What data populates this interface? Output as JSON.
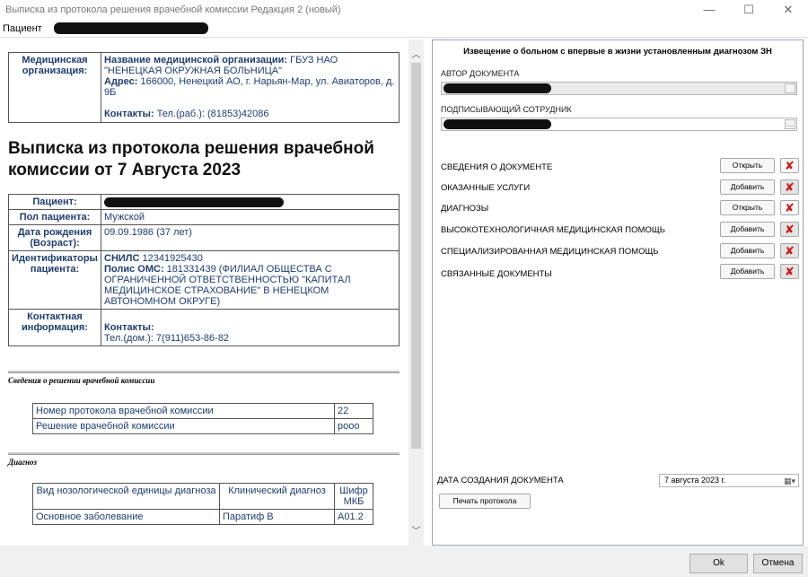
{
  "window": {
    "title": "Выписка из протокола решения врачебной комиссии Редакция 2 (новый)",
    "minimize": "—",
    "maximize": "☐",
    "close": "✕"
  },
  "tabs": {
    "patient_tab": "Пациент"
  },
  "document": {
    "org": {
      "label": "Медицинская организация:",
      "name_label": "Название медицинской организации:",
      "name_value": "ГБУЗ НАО \"НЕНЕЦКАЯ ОКРУЖНАЯ БОЛЬНИЦА\"",
      "address_label": "Адрес:",
      "address_value": "166000, Ненецкий АО, г. Нарьян-Мар, ул. Авиаторов, д. 9Б",
      "contacts_label": "Контакты:",
      "contacts_value": "Тел.(раб.): (81853)42086"
    },
    "title": "Выписка из протокола решения врачебной комиссии от 7 Августа 2023",
    "patient": {
      "patient_label": "Пациент:",
      "sex_label": "Пол пациента:",
      "sex_value": "Мужской",
      "birth_label": "Дата рождения (Возраст):",
      "birth_value": "09.09.1986 (37 лет)",
      "ids_label": "Идентификаторы пациента:",
      "snils_label": "СНИЛС",
      "snils_value": "12341925430",
      "oms_label": "Полис ОМС:",
      "oms_value": "181331439 (ФИЛИАЛ ОБЩЕСТВА С ОГРАНИЧЕННОЙ ОТВЕТСТВЕННОСТЬЮ \"КАПИТАЛ МЕДИЦИНСКОЕ СТРАХОВАНИЕ\" В НЕНЕЦКОМ АВТОНОМНОМ ОКРУГЕ)",
      "contact_label": "Контактная информация:",
      "contact_title": "Контакты:",
      "contact_value": "Тел.(дом.): 7(911)653-86-82"
    },
    "commission_section": {
      "title": "Сведения о решении врачебной комиссии",
      "rows": [
        {
          "name": "Номер протокола врачебной комиссии",
          "value": "22"
        },
        {
          "name": "Решение врачебной комиссии",
          "value": "рооо"
        }
      ]
    },
    "diagnosis_section": {
      "title": "Диагноз",
      "headers": [
        "Вид нозологической единицы диагноза",
        "Клинический диагноз",
        "Шифр МКБ"
      ],
      "rows": [
        {
          "kind": "Основное заболевание",
          "clinical": "Паратиф B",
          "code": "A01.2"
        }
      ]
    }
  },
  "right_panel": {
    "title": "Извещение о больном с впервые в жизни установленным диагнозом ЗН",
    "author_label": "АВТОР ДОКУМЕНТА",
    "signer_label": "ПОДПИСЫВАЮЩИЙ СОТРУДНИК",
    "ellipsis": "...",
    "rows": [
      {
        "label": "СВЕДЕНИЯ О ДОКУМЕНТЕ",
        "button": "Открыть"
      },
      {
        "label": "ОКАЗАННЫЕ УСЛУГИ",
        "button": "Добавить"
      },
      {
        "label": "ДИАГНОЗЫ",
        "button": "Открыть"
      },
      {
        "label": "ВЫСОКОТЕХНОЛОГИЧНАЯ МЕДИЦИНСКАЯ ПОМОЩЬ",
        "button": "Добавить"
      },
      {
        "label": "СПЕЦИАЛИЗИРОВАННАЯ МЕДИЦИНСКАЯ ПОМОЩЬ",
        "button": "Добавить"
      },
      {
        "label": "СВЯЗАННЫЕ ДОКУМЕНТЫ",
        "button": "Добавить"
      }
    ],
    "delete_glyph": "✘",
    "date_label": "ДАТА СОЗДАНИЯ ДОКУМЕНТА",
    "date_value": "7  августа  2023 г.",
    "date_icon": "▦▾",
    "print_button": "Печать протокола"
  },
  "bottom": {
    "ok": "Ok",
    "cancel": "Отмена"
  },
  "colors": {
    "accent_text": "#1f3d6e",
    "delete_red": "#d01515"
  }
}
